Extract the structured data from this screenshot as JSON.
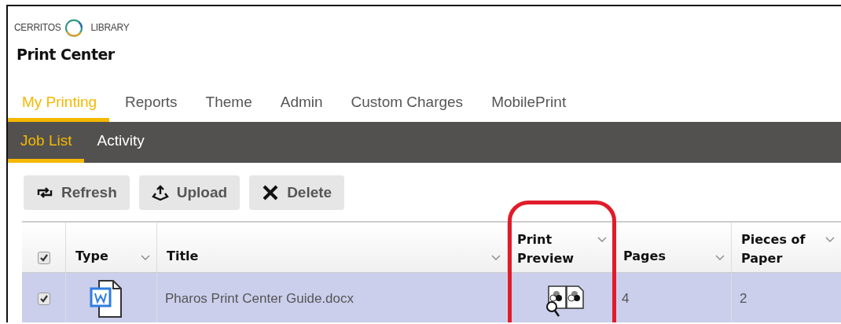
{
  "logo": {
    "left": "CERRITOS",
    "right": "LIBRARY"
  },
  "app_title": "Print Center",
  "tabs": [
    {
      "label": "My Printing",
      "selected": true
    },
    {
      "label": "Reports",
      "selected": false
    },
    {
      "label": "Theme",
      "selected": false
    },
    {
      "label": "Admin",
      "selected": false
    },
    {
      "label": "Custom Charges",
      "selected": false
    },
    {
      "label": "MobilePrint",
      "selected": false
    }
  ],
  "subtabs": [
    {
      "label": "Job List",
      "selected": true
    },
    {
      "label": "Activity",
      "selected": false
    }
  ],
  "toolbar": [
    {
      "kind": "refresh",
      "label": "Refresh"
    },
    {
      "kind": "upload",
      "label": "Upload"
    },
    {
      "kind": "delete",
      "label": "Delete"
    }
  ],
  "table": {
    "select_all": {
      "checked": true
    },
    "columns": [
      {
        "label": "Type",
        "kind": "type"
      },
      {
        "label": "Title",
        "kind": "title"
      },
      {
        "label": "Print Preview",
        "kind": "preview",
        "highlighted": true
      },
      {
        "label": "Pages",
        "kind": "pages"
      },
      {
        "label": "Pieces of Paper",
        "kind": "pieces"
      }
    ],
    "rows": [
      {
        "checked": true,
        "selected": true,
        "title": "Pharos Print Center Guide.docx",
        "pages": "4",
        "pieces": "2"
      }
    ]
  }
}
